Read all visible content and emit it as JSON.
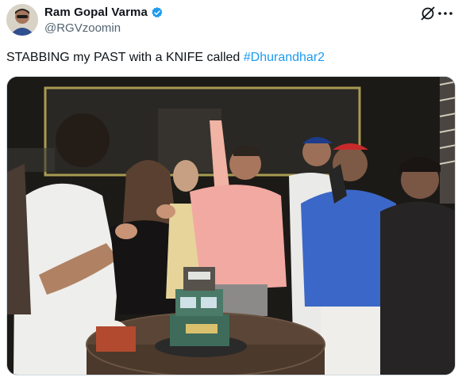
{
  "author": {
    "display_name": "Ram Gopal Varma",
    "handle": "@RGVzoomin",
    "verified": true
  },
  "tweet": {
    "text_prefix": "STABBING my PAST with a KNIFE called ",
    "hashtag": "#Dhurandhar2"
  },
  "icons": {
    "verified": "verified-badge-icon",
    "grok": "grok-icon",
    "more": "more-options-icon"
  },
  "colors": {
    "accent": "#1d9bf0",
    "secondary_text": "#536471"
  }
}
